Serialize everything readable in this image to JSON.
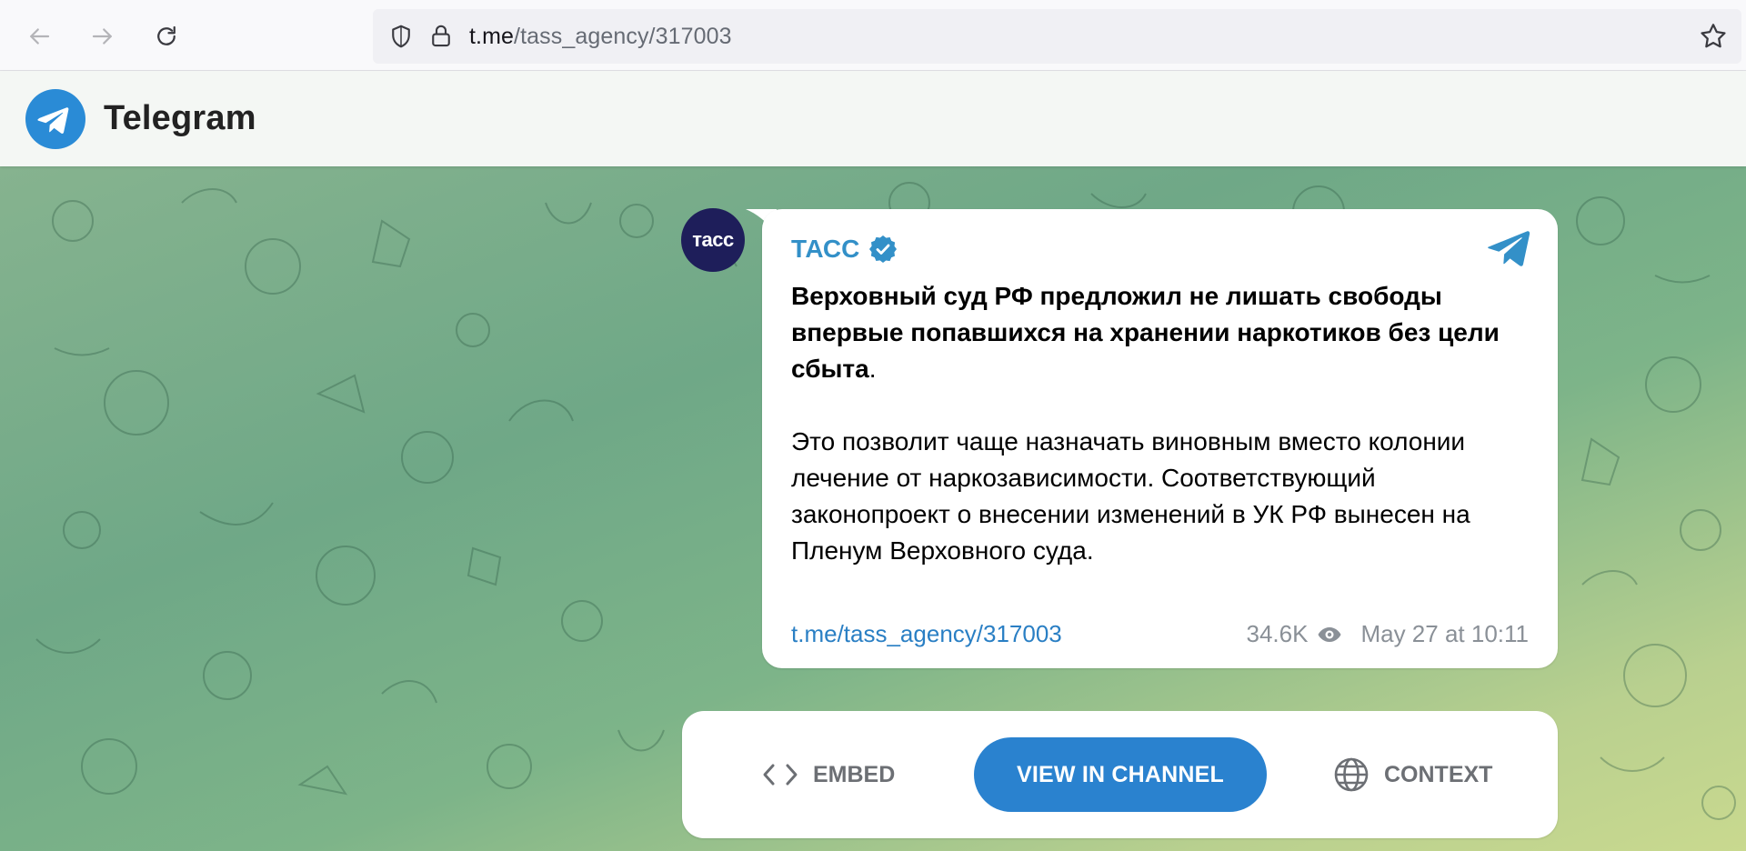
{
  "browser": {
    "url_host": "t.me",
    "url_path": "/tass_agency/317003",
    "icons": [
      "back-arrow-icon",
      "forward-arrow-icon",
      "reload-icon",
      "shield-icon",
      "lock-icon",
      "star-icon"
    ]
  },
  "header": {
    "app_name": "Telegram",
    "logo_icon": "telegram-logo-icon"
  },
  "message": {
    "avatar_text": "тасс",
    "author": "ТАСС",
    "verified_icon": "verified-badge-icon",
    "headline": "Верховный суд РФ предложил не лишать свободы впервые попавшихся на хранении наркотиков без цели сбыта",
    "headline_end": ".",
    "body": "Это позволит чаще назначать виновным вместо колонии лечение от наркозависимости. Соответствующий законопроект о внесении изменений в УК РФ вынесен на Пленум Верховного суда.",
    "link": "t.me/tass_agency/317003",
    "views": "34.6K",
    "date": "May 27 at 10:11"
  },
  "actions": {
    "embed_label": "EMBED",
    "view_label": "VIEW IN CHANNEL",
    "context_label": "CONTEXT"
  },
  "colors": {
    "accent": "#2a82cf",
    "author": "#3390c8",
    "avatar_bg": "#1e1e5a"
  }
}
